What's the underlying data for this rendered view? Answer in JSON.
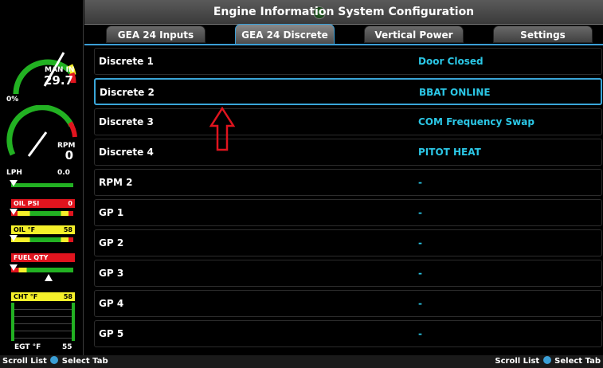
{
  "header": {
    "title": "Engine Information System Configuration"
  },
  "tabs": [
    {
      "label": "GEA 24 Inputs"
    },
    {
      "label": "GEA 24 Discrete"
    },
    {
      "label": "Vertical Power"
    },
    {
      "label": "Settings"
    }
  ],
  "rows": [
    {
      "label": "Discrete 1",
      "value": "Door Closed"
    },
    {
      "label": "Discrete 2",
      "value": "BBAT ONLINE"
    },
    {
      "label": "Discrete 3",
      "value": "COM Frequency Swap"
    },
    {
      "label": "Discrete 4",
      "value": "PITOT HEAT"
    },
    {
      "label": "RPM 2",
      "value": "-"
    },
    {
      "label": "GP 1",
      "value": "-"
    },
    {
      "label": "GP 2",
      "value": "-"
    },
    {
      "label": "GP 3",
      "value": "-"
    },
    {
      "label": "GP 4",
      "value": "-"
    },
    {
      "label": "GP 5",
      "value": "-"
    }
  ],
  "engine": {
    "man_label": "MAN IN",
    "man_value": "29.7",
    "man_pct": "0%",
    "rpm_label": "RPM",
    "rpm_value": "0",
    "lph_label": "LPH",
    "lph_value": "0.0",
    "oil_psi_label": "OIL PSI",
    "oil_psi_value": "0",
    "oil_f_label": "OIL °F",
    "oil_f_value": "58",
    "fuel_label": "FUEL QTY",
    "cht_label": "CHT °F",
    "cht_value": "58",
    "egt_label": "EGT °F",
    "egt_value": "55"
  },
  "softkeys": {
    "left": {
      "a": "Scroll List",
      "b": "Select Tab"
    },
    "right": {
      "a": "Scroll List",
      "b": "Select Tab"
    }
  },
  "colors": {
    "accent": "#3b9fd6",
    "value": "#2bc7e6",
    "alarm": "#e0141e",
    "caution": "#f5f02a",
    "normal": "#22b122",
    "annotation_arrow": "#e0141e"
  }
}
